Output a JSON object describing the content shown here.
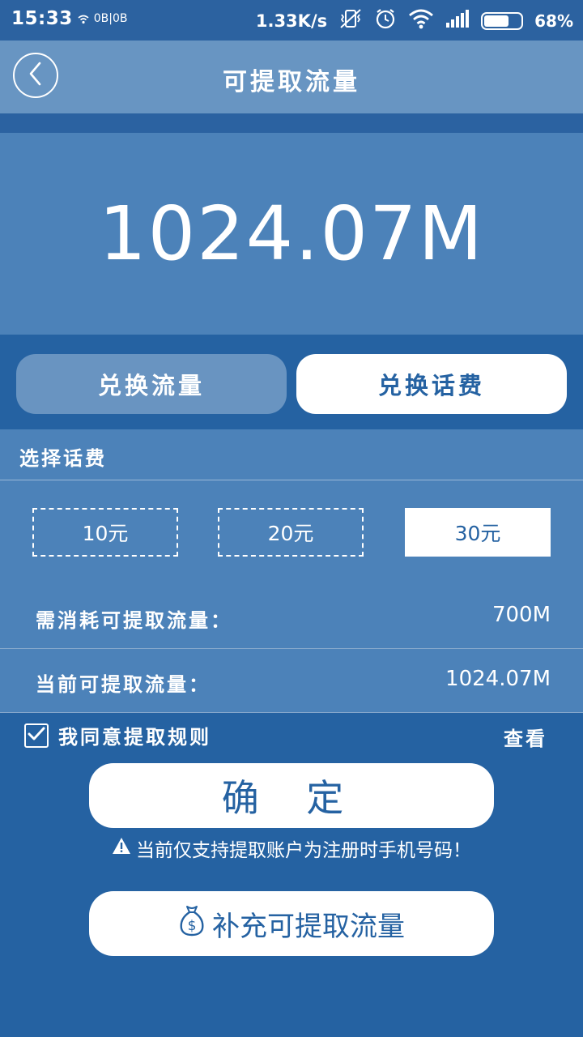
{
  "status_bar": {
    "time": "15:33",
    "data_counter": "0B|0B",
    "speed": "1.33K/s",
    "battery_level": 0.68,
    "battery": "68%"
  },
  "header": {
    "title": "可提取流量",
    "back_icon": "chevron-left-icon"
  },
  "balance": {
    "amount": "1024.07M"
  },
  "tabs": [
    {
      "label": "兑换流量",
      "active": false
    },
    {
      "label": "兑换话费",
      "active": true
    }
  ],
  "select_section": {
    "label": "选择话费"
  },
  "options": [
    {
      "label": "10元",
      "selected": false
    },
    {
      "label": "20元",
      "selected": false
    },
    {
      "label": "30元",
      "selected": true
    }
  ],
  "details": {
    "consume_label": "需消耗可提取流量：",
    "consume_value": "700M",
    "current_label": "当前可提取流量：",
    "current_value": "1024.07M"
  },
  "agreement": {
    "text": "我同意提取规则",
    "checked": true,
    "view_label": "查看"
  },
  "actions": {
    "confirm_label": "确 定",
    "notice": "当前仅支持提取账户为注册时手机号码！",
    "topup_label": "补充可提取流量"
  },
  "colors": {
    "primary": "#2562a2",
    "panel": "#4c82b9",
    "appbar": "#6895c2",
    "white": "#ffffff"
  }
}
